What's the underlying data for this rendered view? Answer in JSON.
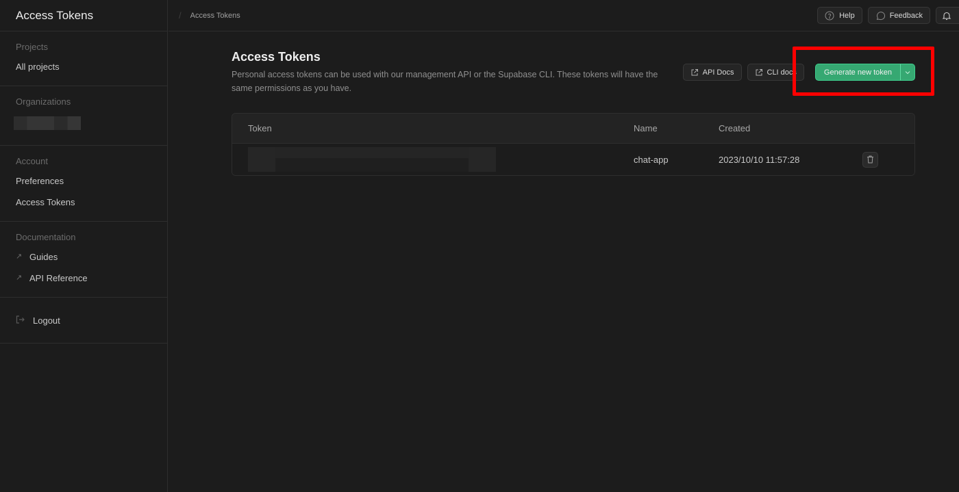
{
  "app": {
    "title": "Access Tokens"
  },
  "breadcrumb": {
    "items": [
      "Access Tokens"
    ]
  },
  "topbar": {
    "help_label": "Help",
    "feedback_label": "Feedback"
  },
  "sidebar": {
    "sections": [
      {
        "title": "Projects",
        "items": [
          {
            "label": "All projects"
          }
        ]
      },
      {
        "title": "Organizations",
        "items": []
      },
      {
        "title": "Account",
        "items": [
          {
            "label": "Preferences"
          },
          {
            "label": "Access Tokens"
          }
        ]
      },
      {
        "title": "Documentation",
        "items": [
          {
            "label": "Guides",
            "icon": "external-arrow-icon"
          },
          {
            "label": "API Reference",
            "icon": "external-arrow-icon"
          }
        ]
      }
    ],
    "logout_label": "Logout"
  },
  "main": {
    "title": "Access Tokens",
    "description": "Personal access tokens can be used with our management API or the Supabase CLI. These tokens will have the same permissions as you have.",
    "api_docs_label": "API Docs",
    "cli_docs_label": "CLI docs",
    "generate_label": "Generate new token"
  },
  "table": {
    "columns": [
      "Token",
      "Name",
      "Created"
    ],
    "rows": [
      {
        "token": "",
        "name": "chat-app",
        "created": "2023/10/10 11:57:28"
      }
    ]
  },
  "colors": {
    "background": "#1c1c1c",
    "brand_green": "#36a872",
    "highlight_red": "#ff0000"
  }
}
